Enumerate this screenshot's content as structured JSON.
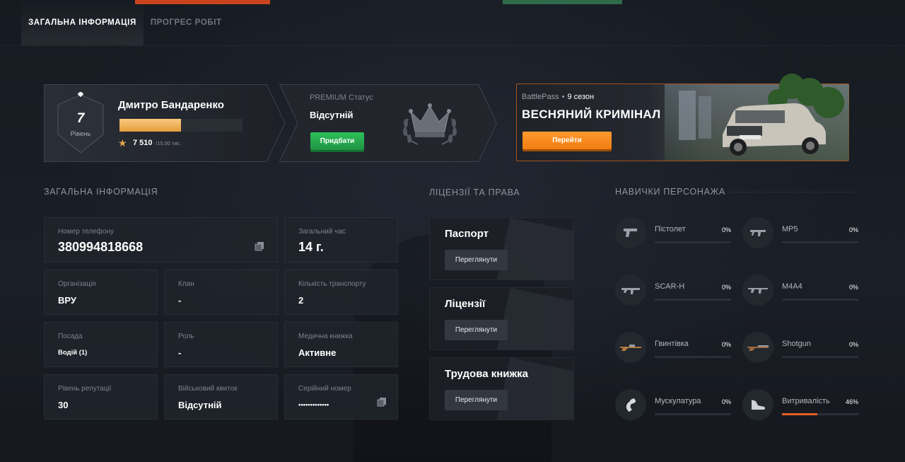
{
  "tabs": [
    {
      "label": "ЗАГАЛЬНА ІНФОРМАЦІЯ",
      "active": true
    },
    {
      "label": "ПРОГРЕС РОБІТ",
      "active": false
    }
  ],
  "profile": {
    "level": "7",
    "level_label": "Рівень",
    "name": "Дмитро Бандаренко",
    "xp_current": "7 510",
    "xp_max": "/15.00 тис.",
    "xp_fraction": 0.5
  },
  "premium": {
    "label": "PREMIUM Статус",
    "value": "Відсутній",
    "button": "Придбати"
  },
  "battlepass": {
    "label": "BattlePass",
    "season": "9 сезон",
    "title": "ВЕСНЯНИЙ КРИМІНАЛ",
    "button": "Перейти"
  },
  "sections": {
    "info": "ЗАГАЛЬНА ІНФОРМАЦІЯ",
    "licenses": "ЛІЦЕНЗІЇ ТА ПРАВА",
    "skills": "НАВИЧКИ ПЕРСОНАЖА"
  },
  "info": {
    "phone": {
      "label": "Номер телефону",
      "value": "380994818668"
    },
    "total_time": {
      "label": "Загальний час",
      "value": "14 г."
    },
    "organization": {
      "label": "Організація",
      "value": "ВРУ"
    },
    "clan": {
      "label": "Клан",
      "value": "-"
    },
    "vehicles": {
      "label": "Кількість транспорту",
      "value": "2"
    },
    "position": {
      "label": "Посада",
      "value": "Водій (1)"
    },
    "role": {
      "label": "Роль",
      "value": "-"
    },
    "medical": {
      "label": "Медична книжка",
      "value": "Активне"
    },
    "reputation": {
      "label": "Рівень репутації",
      "value": "30"
    },
    "military": {
      "label": "Військовий квиток",
      "value": "Відсутній"
    },
    "serial": {
      "label": "Серійний номер",
      "value": "•••••••••••••"
    }
  },
  "documents": [
    {
      "title": "Паспорт",
      "button": "Переглянути"
    },
    {
      "title": "Ліцензії",
      "button": "Переглянути"
    },
    {
      "title": "Трудова книжка",
      "button": "Переглянути"
    }
  ],
  "skills": [
    {
      "name": "Пістолет",
      "pct": "0%",
      "fraction": 0,
      "icon": "pistol-icon"
    },
    {
      "name": "MP5",
      "pct": "0%",
      "fraction": 0,
      "icon": "smg-icon"
    },
    {
      "name": "SCAR-H",
      "pct": "0%",
      "fraction": 0,
      "icon": "rifle-icon"
    },
    {
      "name": "M4A4",
      "pct": "0%",
      "fraction": 0,
      "icon": "assault-rifle-icon"
    },
    {
      "name": "Гвинтівка",
      "pct": "0%",
      "fraction": 0,
      "icon": "sniper-rifle-icon"
    },
    {
      "name": "Shotgun",
      "pct": "0%",
      "fraction": 0,
      "icon": "shotgun-icon"
    },
    {
      "name": "Мускулатура",
      "pct": "0%",
      "fraction": 0,
      "icon": "muscle-icon"
    },
    {
      "name": "Витривалість",
      "pct": "46%",
      "fraction": 0.46,
      "icon": "sneaker-icon"
    }
  ],
  "colors": {
    "accent_orange": "#f07d12",
    "accent_green": "#1f9443",
    "xp_gold": "#e59d3c",
    "skill_fill": "#e35f22"
  }
}
